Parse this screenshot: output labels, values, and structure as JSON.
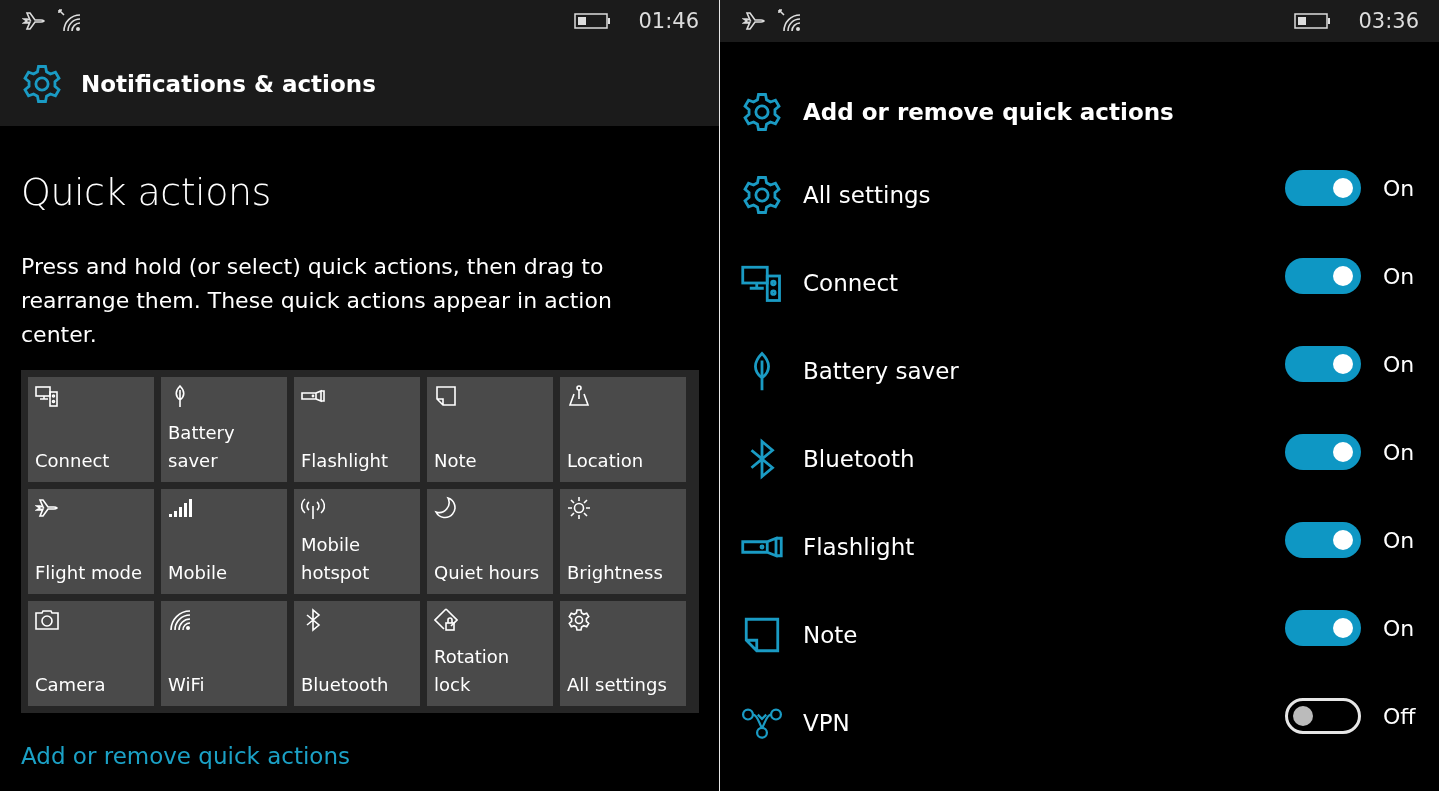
{
  "left_screen": {
    "status_bar": {
      "time": "01:46"
    },
    "header": {
      "title": "Notifications & actions"
    },
    "page_title": "Quick actions",
    "description": "Press and hold (or select) quick actions, then drag to rearrange them. These quick actions appear in action center.",
    "tiles": [
      {
        "label": "Connect"
      },
      {
        "label": "Battery saver"
      },
      {
        "label": "Flashlight"
      },
      {
        "label": "Note"
      },
      {
        "label": "Location"
      },
      {
        "label": "Flight mode"
      },
      {
        "label": "Mobile"
      },
      {
        "label": "Mobile hotspot"
      },
      {
        "label": "Quiet hours"
      },
      {
        "label": "Brightness"
      },
      {
        "label": "Camera"
      },
      {
        "label": "WiFi"
      },
      {
        "label": "Bluetooth"
      },
      {
        "label": "Rotation lock"
      },
      {
        "label": "All settings"
      }
    ],
    "link": "Add or remove quick actions"
  },
  "right_screen": {
    "status_bar": {
      "time": "03:36"
    },
    "header": {
      "title": "Add or remove quick actions"
    },
    "actions": [
      {
        "label": "All settings",
        "on": true,
        "state": "On"
      },
      {
        "label": "Connect",
        "on": true,
        "state": "On"
      },
      {
        "label": "Battery saver",
        "on": true,
        "state": "On"
      },
      {
        "label": "Bluetooth",
        "on": true,
        "state": "On"
      },
      {
        "label": "Flashlight",
        "on": true,
        "state": "On"
      },
      {
        "label": "Note",
        "on": true,
        "state": "On"
      },
      {
        "label": "VPN",
        "on": false,
        "state": "Off"
      }
    ]
  }
}
